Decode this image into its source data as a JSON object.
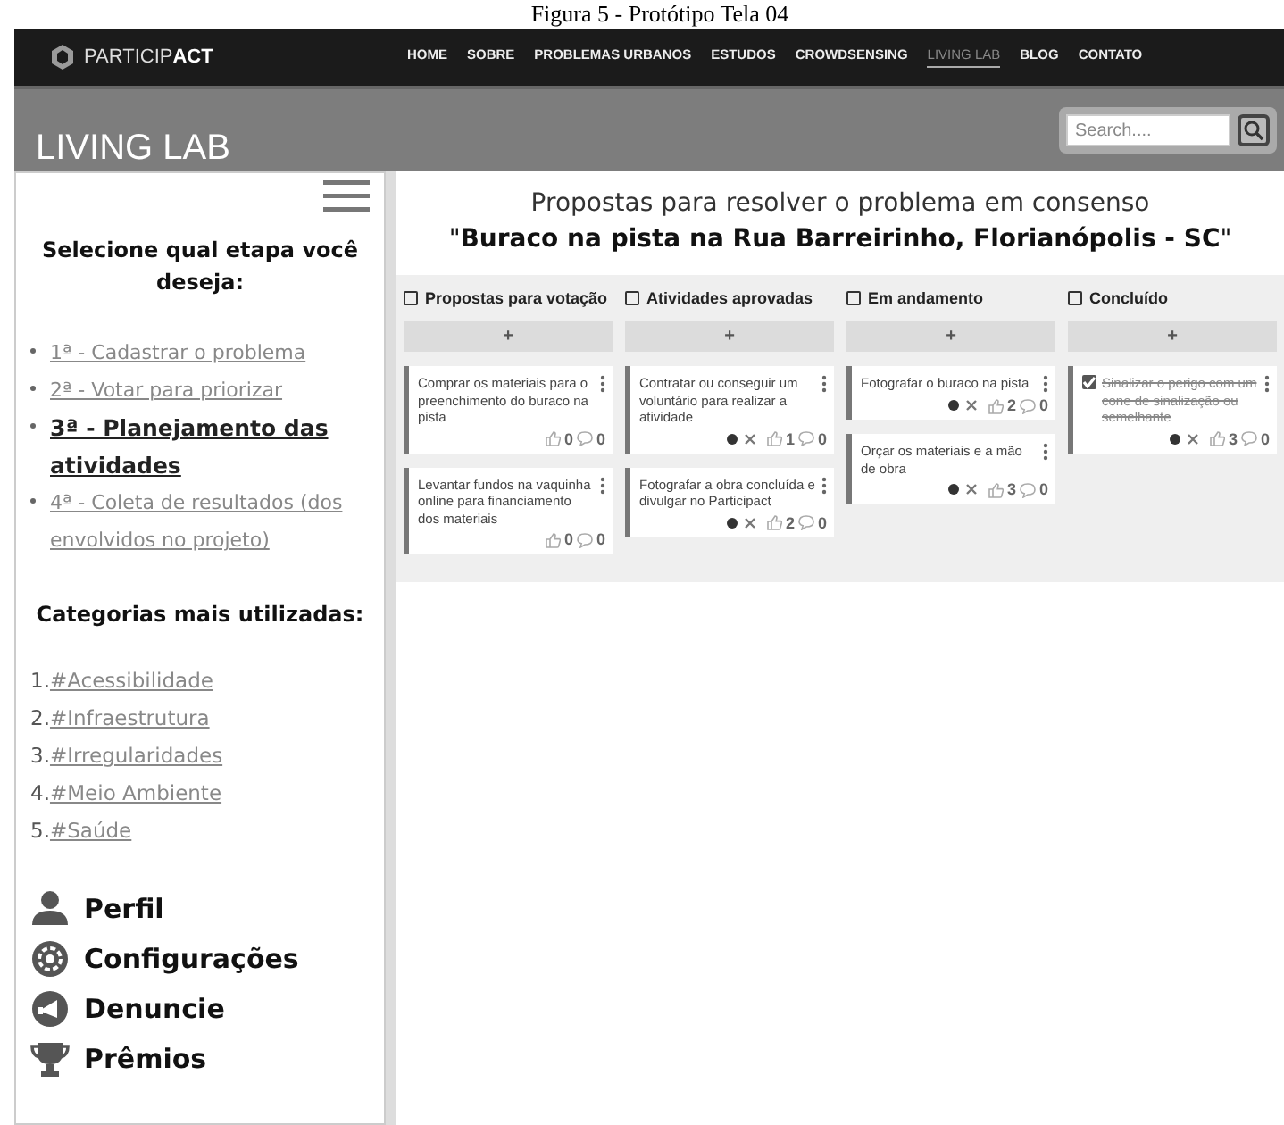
{
  "caption": "Figura 5 - Protótipo Tela 04",
  "header": {
    "logo_light": "PARTICIP",
    "logo_bold": "ACT",
    "nav": [
      {
        "label": "HOME",
        "selected": false
      },
      {
        "label": "SOBRE",
        "selected": false
      },
      {
        "label": "PROBLEMAS URBANOS",
        "selected": false
      },
      {
        "label": "ESTUDOS",
        "selected": false
      },
      {
        "label": "CROWDSENSING",
        "selected": false
      },
      {
        "label": "LIVING LAB",
        "selected": true
      },
      {
        "label": "BLOG",
        "selected": false
      },
      {
        "label": "CONTATO",
        "selected": false
      }
    ]
  },
  "banner": {
    "title": "LIVING LAB",
    "search": {
      "placeholder": "Search...."
    }
  },
  "sidebar": {
    "steps_title": "Selecione qual etapa você deseja:",
    "steps": [
      {
        "label": "1ª - Cadastrar o problema",
        "selected": false
      },
      {
        "label": "2ª - Votar para priorizar",
        "selected": false
      },
      {
        "label": "3ª - Planejamento das atividades",
        "selected": true
      },
      {
        "label": "4ª - Coleta de resultados (dos envolvidos no projeto)",
        "selected": false
      }
    ],
    "categories_title": "Categorias mais utilizadas:",
    "categories": [
      {
        "number": "1.",
        "label": "#Acessibilidade"
      },
      {
        "number": "2.",
        "label": "#Infraestrutura"
      },
      {
        "number": "3.",
        "label": "#Irregularidades"
      },
      {
        "number": "4.",
        "label": "#Meio Ambiente"
      },
      {
        "number": "5.",
        "label": "#Saúde"
      }
    ],
    "menu": [
      {
        "kind": "profile",
        "label": "Perfil"
      },
      {
        "kind": "settings",
        "label": "Configurações"
      },
      {
        "kind": "report",
        "label": "Denuncie"
      },
      {
        "kind": "awards",
        "label": "Prêmios"
      }
    ]
  },
  "main": {
    "title": "Propostas para resolver o problema em consenso",
    "subtitle": "\"**Buraco na pista na Rua Barreirinho, Florianópolis - SC**\"",
    "columns": [
      {
        "title": "Propostas para votação",
        "add": "+",
        "cards": [
          {
            "text": "Comprar os materiais para o preenchimento do buraco na pista",
            "assigned": false,
            "done": false,
            "likes": "0",
            "comments": "0"
          },
          {
            "text": "Levantar fundos na vaquinha online para financiamento dos materiais",
            "assigned": false,
            "done": false,
            "likes": "0",
            "comments": "0"
          }
        ]
      },
      {
        "title": "Atividades aprovadas",
        "add": "+",
        "cards": [
          {
            "text": "Contratar ou conseguir um voluntário para realizar a atividade",
            "assigned": true,
            "done": false,
            "likes": "1",
            "comments": "0"
          },
          {
            "text": "Fotografar a obra concluída e divulgar no Participact",
            "assigned": true,
            "done": false,
            "likes": "2",
            "comments": "0"
          }
        ]
      },
      {
        "title": "Em andamento",
        "add": "+",
        "cards": [
          {
            "text": "Fotografar o buraco na pista",
            "assigned": true,
            "done": false,
            "likes": "2",
            "comments": "0"
          },
          {
            "text": "Orçar os materiais e a mão de obra",
            "assigned": true,
            "done": false,
            "likes": "3",
            "comments": "0"
          }
        ]
      },
      {
        "title": "Concluído",
        "add": "+",
        "cards": [
          {
            "text": "Sinalizar o perigo com um cone de sinalização ou semelhante",
            "assigned": true,
            "done": true,
            "likes": "3",
            "comments": "0"
          }
        ]
      }
    ]
  }
}
